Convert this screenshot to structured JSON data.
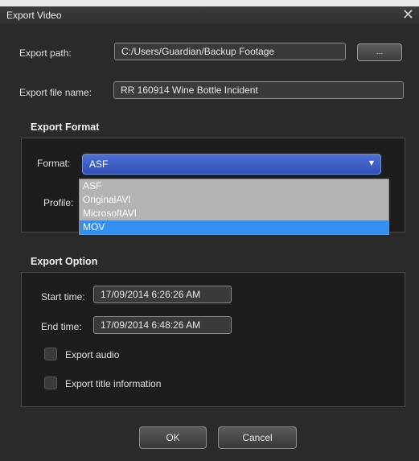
{
  "window": {
    "title": "Export Video"
  },
  "export_path": {
    "label": "Export path:",
    "value": "C:/Users/Guardian/Backup Footage",
    "browse_label": "..."
  },
  "export_file_name": {
    "label": "Export file name:",
    "value": "RR 160914 Wine Bottle Incident"
  },
  "export_format": {
    "title": "Export Format",
    "format_label": "Format:",
    "format_value": "ASF",
    "profile_label": "Profile:",
    "options": [
      "ASF",
      "OriginalAVI",
      "MicrosoftAVI",
      "MOV"
    ],
    "highlighted_option": "MOV"
  },
  "export_option": {
    "title": "Export Option",
    "start_label": "Start time:",
    "start_value": "17/09/2014 6:26:26 AM",
    "end_label": "End time:",
    "end_value": "17/09/2014 6:48:26 AM",
    "export_audio_label": "Export audio",
    "export_audio_checked": false,
    "export_title_label": "Export title information",
    "export_title_checked": false
  },
  "buttons": {
    "ok": "OK",
    "cancel": "Cancel"
  },
  "colors": {
    "accent": "#3390f0",
    "dialog_bg": "#2a2a2a",
    "panel_bg": "#1d1d1d"
  }
}
